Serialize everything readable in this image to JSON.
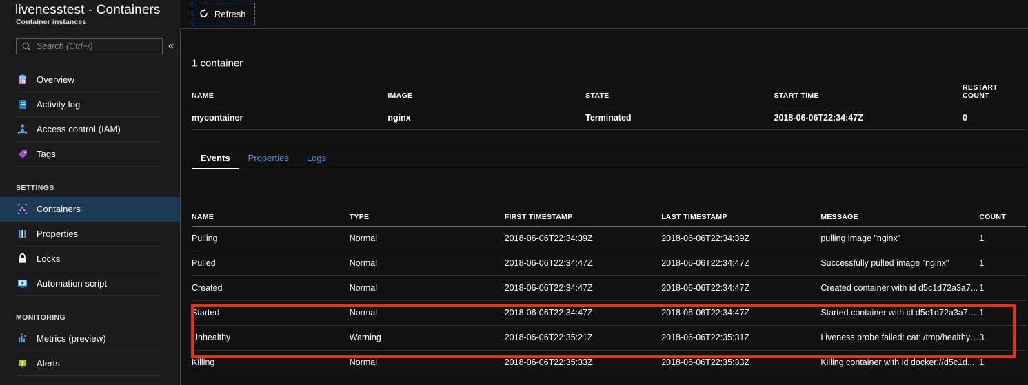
{
  "blade": {
    "title": "livenesstest - Containers",
    "subtitle": "Container instances"
  },
  "search": {
    "placeholder": "Search (Ctrl+/)",
    "icon": "search-icon",
    "collapse_icon": "«"
  },
  "sidebar": {
    "top_items": [
      {
        "label": "Overview",
        "icon": "overview-icon"
      },
      {
        "label": "Activity log",
        "icon": "activity-log-icon"
      },
      {
        "label": "Access control (IAM)",
        "icon": "access-control-icon"
      },
      {
        "label": "Tags",
        "icon": "tags-icon"
      }
    ],
    "sections": [
      {
        "header": "SETTINGS",
        "items": [
          {
            "label": "Containers",
            "icon": "containers-icon",
            "selected": true
          },
          {
            "label": "Properties",
            "icon": "properties-icon",
            "selected": false
          },
          {
            "label": "Locks",
            "icon": "locks-icon",
            "selected": false
          },
          {
            "label": "Automation script",
            "icon": "automation-script-icon",
            "selected": false
          }
        ]
      },
      {
        "header": "MONITORING",
        "items": [
          {
            "label": "Metrics (preview)",
            "icon": "metrics-icon",
            "selected": false
          },
          {
            "label": "Alerts",
            "icon": "alerts-icon",
            "selected": false
          }
        ]
      }
    ]
  },
  "toolbar": {
    "refresh_label": "Refresh",
    "refresh_icon": "refresh-icon"
  },
  "containers": {
    "count_label": "1 container",
    "columns": [
      "NAME",
      "IMAGE",
      "STATE",
      "START TIME",
      "RESTART COUNT"
    ],
    "rows": [
      {
        "name": "mycontainer",
        "image": "nginx",
        "state": "Terminated",
        "start_time": "2018-06-06T22:34:47Z",
        "restart_count": "0"
      }
    ]
  },
  "tabs": [
    {
      "label": "Events",
      "active": true
    },
    {
      "label": "Properties",
      "active": false
    },
    {
      "label": "Logs",
      "active": false
    }
  ],
  "events": {
    "columns": [
      "NAME",
      "TYPE",
      "FIRST TIMESTAMP",
      "LAST TIMESTAMP",
      "MESSAGE",
      "COUNT"
    ],
    "rows": [
      {
        "name": "Pulling",
        "type": "Normal",
        "first_timestamp": "2018-06-06T22:34:39Z",
        "last_timestamp": "2018-06-06T22:34:39Z",
        "message": "pulling image \"nginx\"",
        "count": "1",
        "highlighted": false
      },
      {
        "name": "Pulled",
        "type": "Normal",
        "first_timestamp": "2018-06-06T22:34:47Z",
        "last_timestamp": "2018-06-06T22:34:47Z",
        "message": "Successfully pulled image \"nginx\"",
        "count": "1",
        "highlighted": false
      },
      {
        "name": "Created",
        "type": "Normal",
        "first_timestamp": "2018-06-06T22:34:47Z",
        "last_timestamp": "2018-06-06T22:34:47Z",
        "message": "Created container with id d5c1d72a3a7...",
        "count": "1",
        "highlighted": false
      },
      {
        "name": "Started",
        "type": "Normal",
        "first_timestamp": "2018-06-06T22:34:47Z",
        "last_timestamp": "2018-06-06T22:34:47Z",
        "message": "Started container with id d5c1d72a3a78...",
        "count": "1",
        "highlighted": false
      },
      {
        "name": "Unhealthy",
        "type": "Warning",
        "first_timestamp": "2018-06-06T22:35:21Z",
        "last_timestamp": "2018-06-06T22:35:31Z",
        "message": "Liveness probe failed: cat: /tmp/healthy:...",
        "count": "3",
        "highlighted": true
      },
      {
        "name": "Killing",
        "type": "Normal",
        "first_timestamp": "2018-06-06T22:35:33Z",
        "last_timestamp": "2018-06-06T22:35:33Z",
        "message": "Killing container with id docker://d5c1d...",
        "count": "1",
        "highlighted": true
      }
    ]
  },
  "annotation": {
    "highlight_color": "#f02f10",
    "description": "red-highlight-box"
  },
  "colors": {
    "background": "#111111",
    "sidebar_background": "#1b1b1b",
    "selected_nav": "#1c3a53",
    "link_blue": "#3aa0f3",
    "focus_outline": "#33a0e8"
  }
}
